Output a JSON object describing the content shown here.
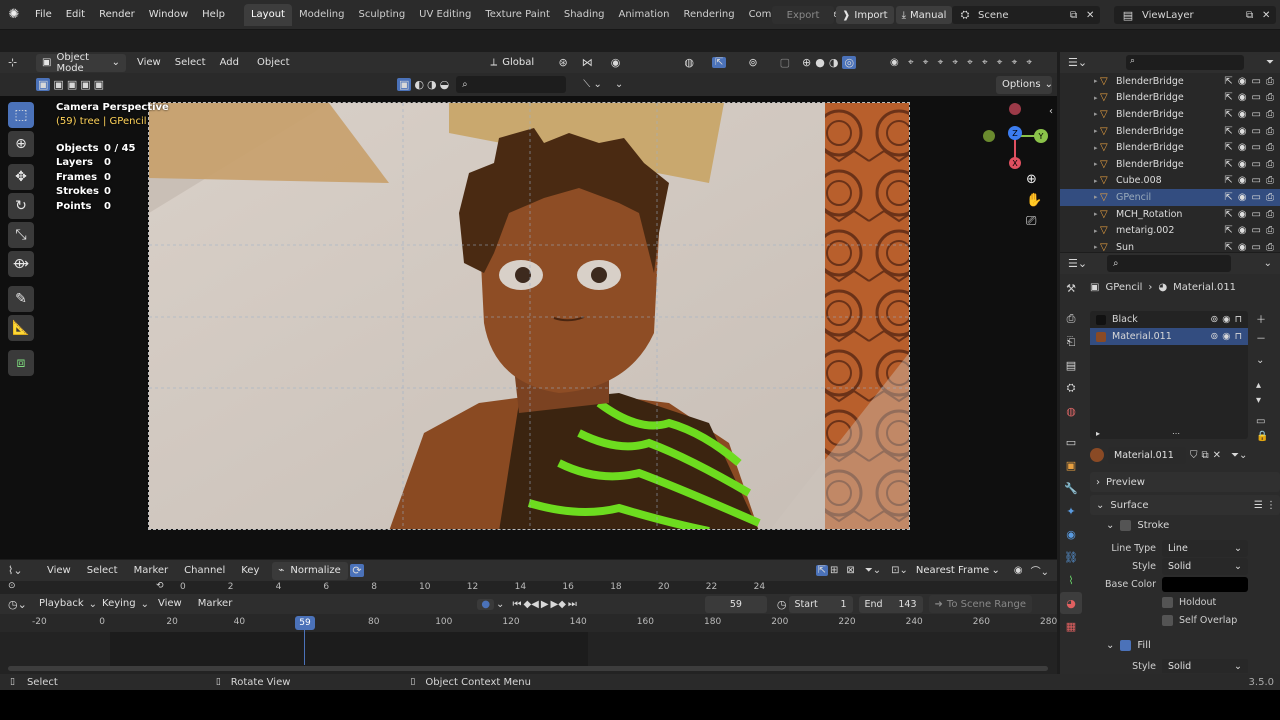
{
  "menubar": {
    "items": [
      "File",
      "Edit",
      "Render",
      "Window",
      "Help"
    ],
    "workspaces": [
      "Layout",
      "Modeling",
      "Sculpting",
      "UV Editing",
      "Texture Paint",
      "Shading",
      "Animation",
      "Rendering",
      "Compositing",
      "Ge"
    ],
    "active_workspace": "Layout",
    "export_label": "Export",
    "import_label": "Import",
    "manual_label": "Manual",
    "scene_label": "Scene",
    "viewlayer_label": "ViewLayer"
  },
  "viewport_header": {
    "mode": "Object Mode",
    "menus": [
      "View",
      "Select",
      "Add",
      "Object"
    ],
    "transform": "Global",
    "options": "Options"
  },
  "viewport": {
    "perspective": "Camera Perspective",
    "subtitle": "(59) tree | GPencil",
    "stats": [
      {
        "label": "Objects",
        "value": "0 / 45"
      },
      {
        "label": "Layers",
        "value": "0"
      },
      {
        "label": "Frames",
        "value": "0"
      },
      {
        "label": "Strokes",
        "value": "0"
      },
      {
        "label": "Points",
        "value": "0"
      }
    ],
    "gizmo": {
      "x": "X",
      "y": "Y",
      "z": "Z"
    }
  },
  "outliner": {
    "rows": [
      {
        "name": "BlenderBridge",
        "selected": false
      },
      {
        "name": "BlenderBridge",
        "selected": false
      },
      {
        "name": "BlenderBridge",
        "selected": false
      },
      {
        "name": "BlenderBridge",
        "selected": false
      },
      {
        "name": "BlenderBridge",
        "selected": false
      },
      {
        "name": "BlenderBridge",
        "selected": false
      },
      {
        "name": "Cube.008",
        "selected": false
      },
      {
        "name": "GPencil",
        "selected": true
      },
      {
        "name": "MCH_Rotation",
        "selected": false
      },
      {
        "name": "metarig.002",
        "selected": false
      },
      {
        "name": "Sun",
        "selected": false
      }
    ]
  },
  "properties": {
    "breadcrumb_object": "GPencil",
    "breadcrumb_material": "Material.011",
    "materials": [
      {
        "name": "Black",
        "color": "#111111"
      },
      {
        "name": "Material.011",
        "color": "#8a4a25"
      }
    ],
    "material_name": "Material.011",
    "preview_label": "Preview",
    "surface_label": "Surface",
    "stroke_label": "Stroke",
    "line_type_label": "Line Type",
    "line_type_value": "Line",
    "style_label": "Style",
    "style_value": "Solid",
    "base_color_label": "Base Color",
    "holdout_label": "Holdout",
    "self_overlap_label": "Self Overlap",
    "fill_label": "Fill",
    "fill_style_label": "Style",
    "fill_style_value": "Solid"
  },
  "dopesheet": {
    "menus": [
      "View",
      "Select",
      "Marker",
      "Channel",
      "Key"
    ],
    "normalize": "Normalize",
    "snap": "Nearest Frame",
    "ruler": [
      "0",
      "2",
      "4",
      "6",
      "8",
      "10",
      "12",
      "14",
      "16",
      "18",
      "20",
      "22",
      "24"
    ]
  },
  "timeline": {
    "menus": [
      "Playback",
      "Keying",
      "View",
      "Marker"
    ],
    "current_frame": "59",
    "start_label": "Start",
    "start_value": "1",
    "end_label": "End",
    "end_value": "143",
    "scene_range": "To Scene Range",
    "ruler": [
      "-20",
      "0",
      "20",
      "40",
      "60",
      "80",
      "100",
      "120",
      "140",
      "160",
      "180",
      "200",
      "220",
      "240",
      "260",
      "280"
    ],
    "playhead": "59"
  },
  "statusbar": {
    "select": "Select",
    "rotate": "Rotate View",
    "context": "Object Context Menu",
    "version": "3.5.0"
  }
}
